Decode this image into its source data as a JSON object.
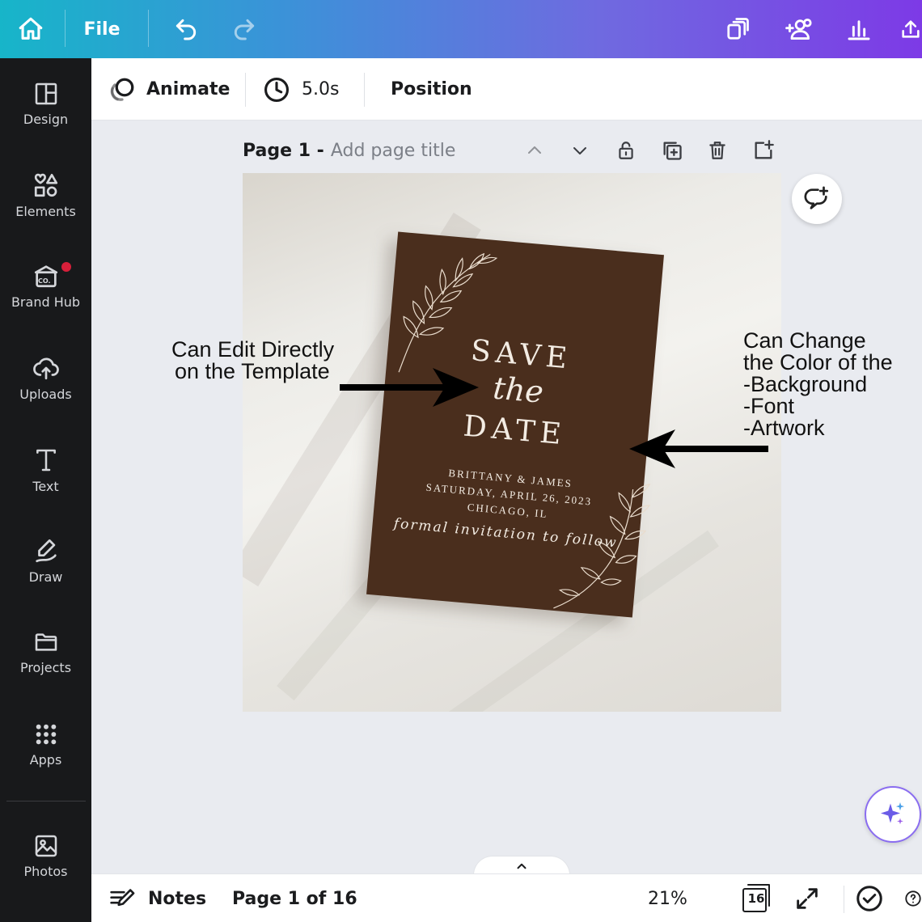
{
  "topbar": {
    "file_label": "File",
    "icons": [
      "home-icon",
      "undo-icon",
      "redo-icon",
      "resize-icon",
      "share-people-icon",
      "insights-icon",
      "upload-icon"
    ]
  },
  "sidebar": {
    "items": [
      {
        "label": "Design",
        "icon": "design-icon"
      },
      {
        "label": "Elements",
        "icon": "elements-icon"
      },
      {
        "label": "Brand Hub",
        "icon": "brand-hub-icon",
        "logo_text": "CO."
      },
      {
        "label": "Uploads",
        "icon": "cloud-upload-icon"
      },
      {
        "label": "Text",
        "icon": "text-icon"
      },
      {
        "label": "Draw",
        "icon": "draw-icon"
      },
      {
        "label": "Projects",
        "icon": "folder-icon"
      },
      {
        "label": "Apps",
        "icon": "apps-grid-icon"
      },
      {
        "label": "Photos",
        "icon": "photos-icon"
      }
    ]
  },
  "context_toolbar": {
    "animate_label": "Animate",
    "duration_label": "5.0s",
    "position_label": "Position"
  },
  "page_header": {
    "title": "Page 1 -",
    "placeholder": "Add page title"
  },
  "card": {
    "line_save": "SAVE",
    "line_the": "the",
    "line_date": "DATE",
    "names": "BRITTANY & JAMES",
    "date": "SATURDAY, APRIL 26, 2023",
    "location": "CHICAGO, IL",
    "follow": "formal invitation to follow",
    "color": "#4a2e1d"
  },
  "annotations": {
    "left_line1": "Can Edit Directly",
    "left_line2": "on the Template",
    "right_line1": "Can Change",
    "right_line2": "the Color of the",
    "right_line3": "-Background",
    "right_line4": "-Font",
    "right_line5": "-Artwork"
  },
  "bottombar": {
    "notes_label": "Notes",
    "page_indicator": "Page 1 of 16",
    "zoom": "21%",
    "page_count_badge": "16"
  },
  "colors": {
    "gradient_start": "#17b5c9",
    "gradient_end": "#7d3ae6",
    "sidebar_bg": "#18191b",
    "notification_dot": "#d71f3a"
  }
}
